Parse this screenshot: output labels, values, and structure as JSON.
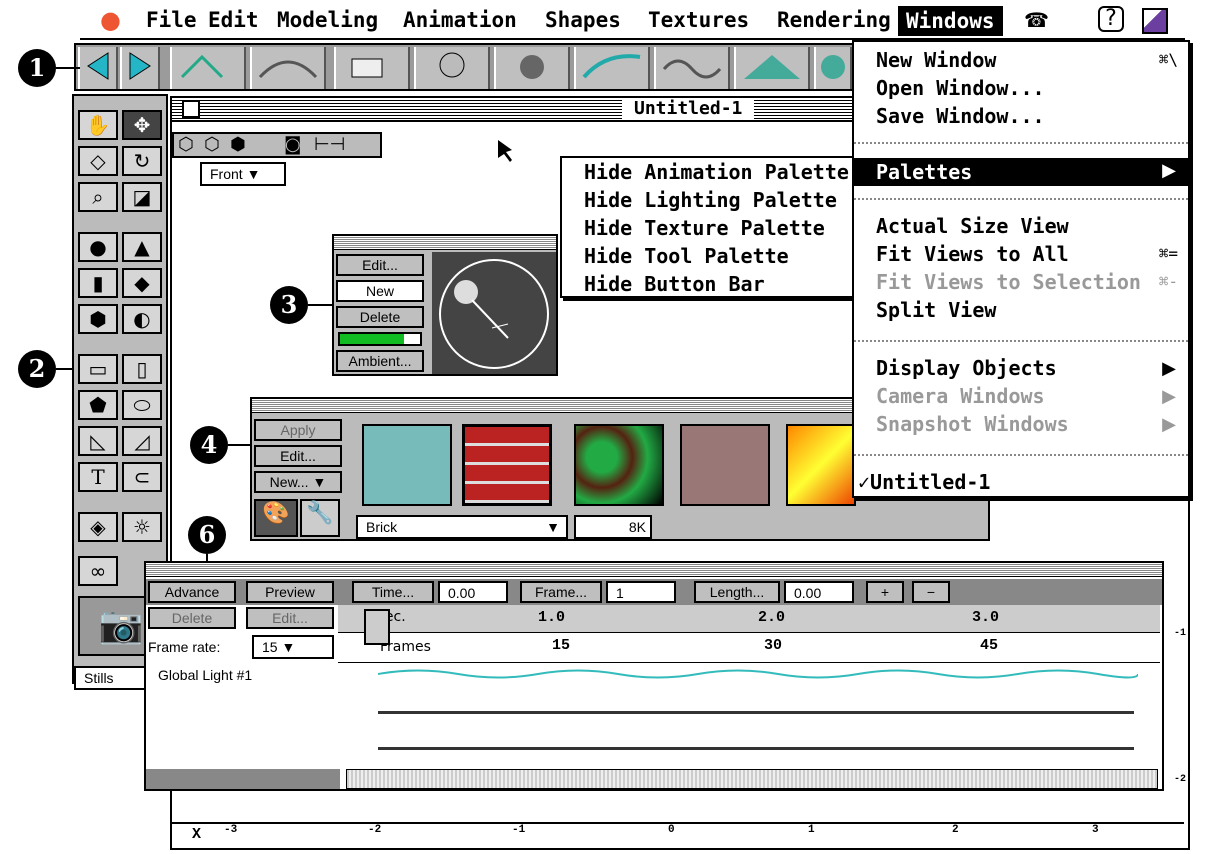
{
  "menubar": {
    "items": [
      "File",
      "Edit",
      "Modeling",
      "Animation",
      "Shapes",
      "Textures",
      "Rendering",
      "Windows"
    ]
  },
  "windows_menu": {
    "new_window": "New Window",
    "new_window_sc": "⌘\\",
    "open_window": "Open Window...",
    "save_window": "Save Window...",
    "palettes": "Palettes",
    "actual_size": "Actual Size View",
    "fit_all": "Fit Views to All",
    "fit_all_sc": "⌘=",
    "fit_sel": "Fit Views to Selection",
    "fit_sel_sc": "⌘-",
    "split": "Split View",
    "display_objects": "Display Objects",
    "camera_windows": "Camera Windows",
    "snapshot_windows": "Snapshot Windows",
    "untitled": "✓Untitled-1"
  },
  "palettes_submenu": [
    "Hide Animation Palette",
    "Hide Lighting Palette",
    "Hide Texture Palette",
    "Hide Tool Palette",
    "Hide Button Bar"
  ],
  "window": {
    "title": "Untitled-1",
    "view_select": "Front"
  },
  "light_palette": {
    "edit": "Edit...",
    "new": "New",
    "delete": "Delete",
    "ambient": "Ambient..."
  },
  "texture_palette": {
    "apply": "Apply",
    "edit": "Edit...",
    "new": "New...",
    "selected": "Brick",
    "size": "8K"
  },
  "callouts": [
    "1",
    "2",
    "3",
    "4",
    "6"
  ],
  "animation": {
    "advance": "Advance",
    "preview": "Preview",
    "delete": "Delete",
    "edit": "Edit...",
    "time_btn": "Time...",
    "time_val": "0.00",
    "frame_btn": "Frame...",
    "frame_val": "1",
    "length_btn": "Length...",
    "length_val": "0.00",
    "plus": "+",
    "minus": "−",
    "frame_rate_label": "Frame rate:",
    "frame_rate": "15",
    "sec_label": "Sec.",
    "frames_label": "Frames",
    "sec_ticks": [
      "1.0",
      "2.0",
      "3.0"
    ],
    "frame_ticks": [
      "15",
      "30",
      "45"
    ],
    "track_name": "Global Light #1"
  },
  "stills": "Stills",
  "ruler": {
    "x_label": "X",
    "ticks": [
      "-3",
      "-2",
      "-1",
      "0",
      "1",
      "2",
      "3"
    ],
    "side": [
      "-1",
      "-2"
    ]
  }
}
